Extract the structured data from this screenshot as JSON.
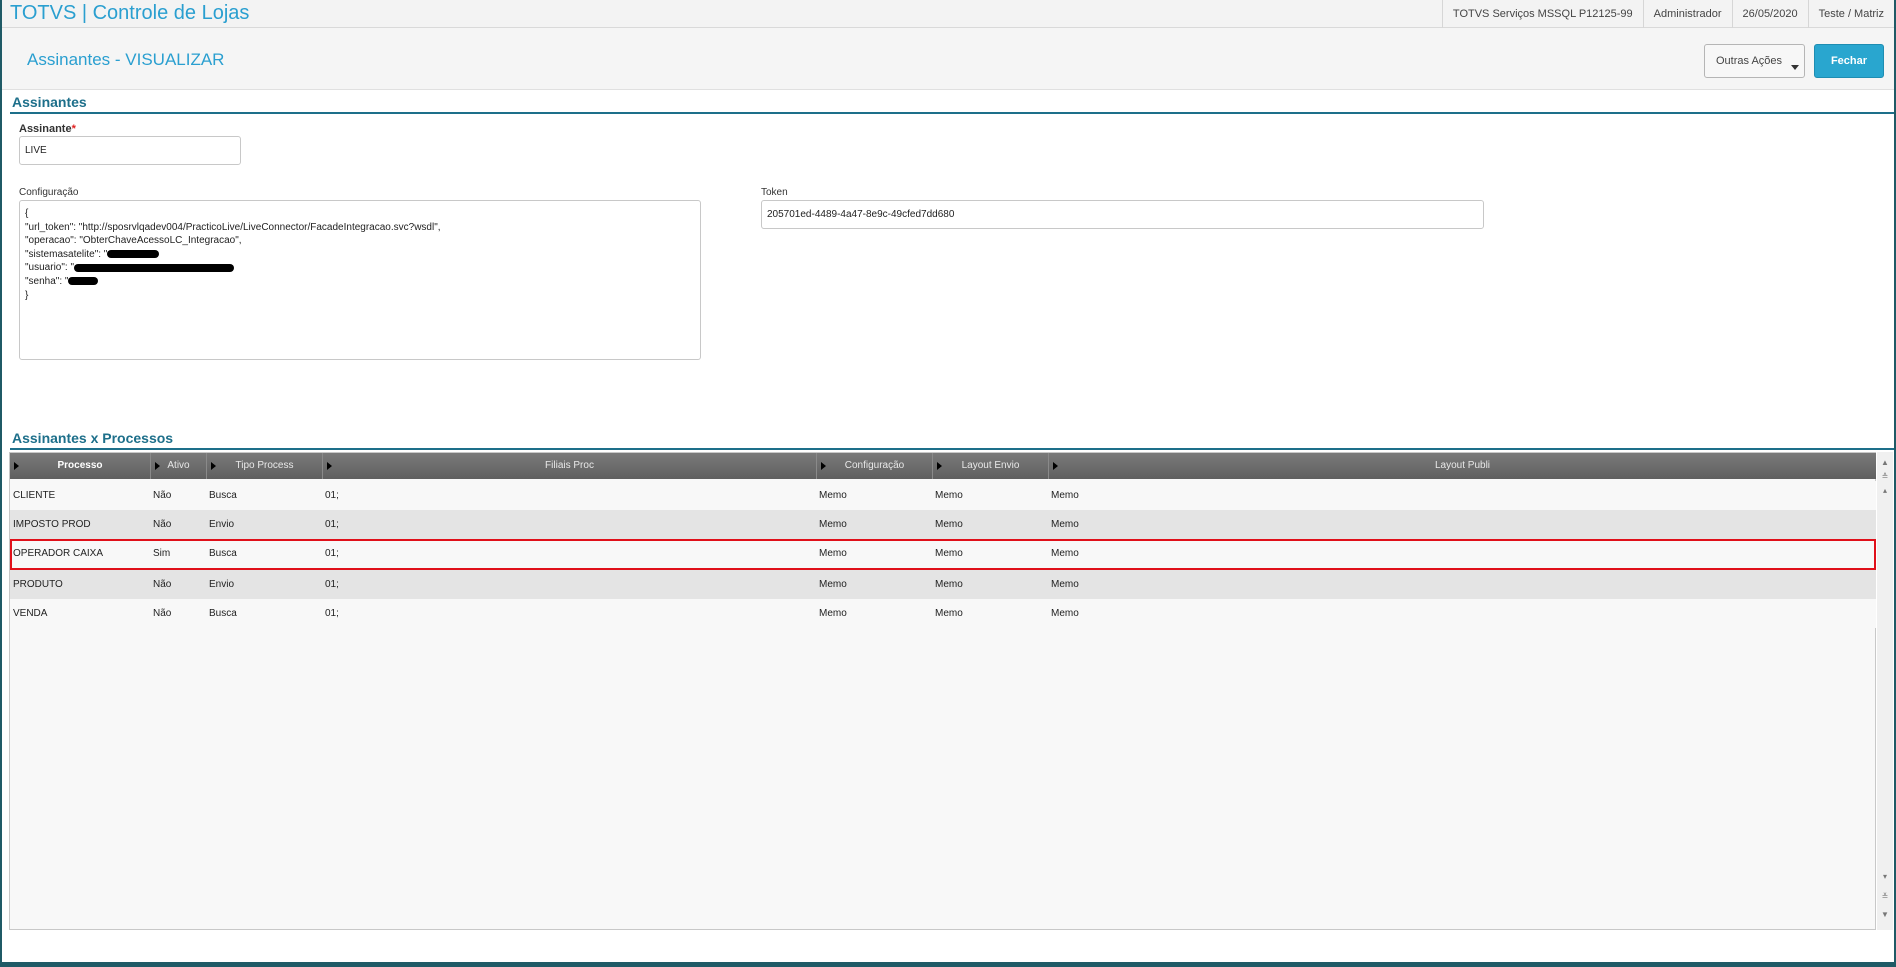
{
  "app": {
    "title": "TOTVS | Controle de Lojas",
    "server": "TOTVS Serviços MSSQL P12125-99",
    "user": "Administrador",
    "date": "26/05/2020",
    "branch": "Teste / Matriz"
  },
  "header": {
    "title": "Assinantes - VISUALIZAR",
    "other_actions_label": "Outras Ações",
    "close_label": "Fechar"
  },
  "form": {
    "section_title": "Assinantes",
    "subscriber_label": "Assinante",
    "required_mark": "*",
    "subscriber_value": "LIVE",
    "config_label": "Configuração",
    "config_lines": {
      "l1": "{",
      "l2": "\"url_token\": \"http://sposrvlqadev004/PracticoLive/LiveConnector/FacadeIntegracao.svc?wsdl\",",
      "l3": "\"operacao\": \"ObterChaveAcessoLC_Integracao\",",
      "l4": "\"sistemasatelite\": \"",
      "l5": "\"usuario\": \"",
      "l6": "\"senha\": \"",
      "l7": "}"
    },
    "token_label": "Token",
    "token_value": "205701ed-4489-4a47-8e9c-49cfed7dd680"
  },
  "grid": {
    "section_title": "Assinantes x Processos",
    "columns": {
      "processo": "Processo",
      "ativo": "Ativo",
      "tipo": "Tipo Process",
      "filiais": "Filiais Proc",
      "config": "Configuração",
      "layout_envio": "Layout Envio",
      "layout_publi": "Layout Publi"
    },
    "rows": [
      {
        "processo": "CLIENTE",
        "ativo": "Não",
        "tipo": "Busca",
        "filiais": "01;",
        "config": "Memo",
        "layout_envio": "Memo",
        "layout_publi": "Memo"
      },
      {
        "processo": "IMPOSTO PROD",
        "ativo": "Não",
        "tipo": "Envio",
        "filiais": "01;",
        "config": "Memo",
        "layout_envio": "Memo",
        "layout_publi": "Memo"
      },
      {
        "processo": "OPERADOR CAIXA",
        "ativo": "Sim",
        "tipo": "Busca",
        "filiais": "01;",
        "config": "Memo",
        "layout_envio": "Memo",
        "layout_publi": "Memo"
      },
      {
        "processo": "PRODUTO",
        "ativo": "Não",
        "tipo": "Envio",
        "filiais": "01;",
        "config": "Memo",
        "layout_envio": "Memo",
        "layout_publi": "Memo"
      },
      {
        "processo": "VENDA",
        "ativo": "Não",
        "tipo": "Busca",
        "filiais": "01;",
        "config": "Memo",
        "layout_envio": "Memo",
        "layout_publi": "Memo"
      }
    ],
    "highlight_color": "#e0101a"
  },
  "colors": {
    "brand": "#2a9fd0",
    "section": "#1d6f8a",
    "primary_button": "#29a6cf"
  }
}
